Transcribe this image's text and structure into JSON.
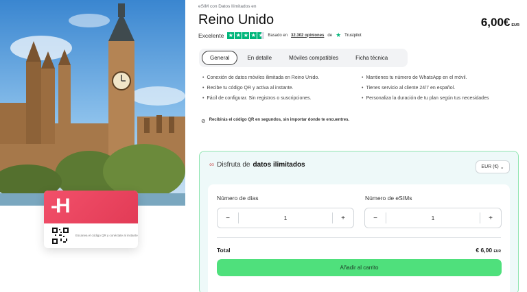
{
  "product": {
    "subtitle": "eSIM con Datos Ilimitados en",
    "title": "Reino Unido",
    "price": "6,00€",
    "price_currency": "EUR"
  },
  "rating": {
    "label": "Excelente",
    "based_on": "Basado en",
    "count": "32.302 opiniones",
    "on": "de",
    "source": "Trustpilot",
    "stars": 4.5
  },
  "tabs": [
    {
      "label": "General",
      "active": true
    },
    {
      "label": "En detalle",
      "active": false
    },
    {
      "label": "Móviles compatibles",
      "active": false
    },
    {
      "label": "Ficha técnica",
      "active": false
    }
  ],
  "features": {
    "left": [
      "Conexión de datos móviles ilimitada en Reino Unido.",
      "Recibe tu código QR y activa al instante.",
      "Fácil de configurar. Sin registros o suscripciones."
    ],
    "right": [
      "Mantienes tu número de WhatsApp en el móvil.",
      "Tienes servicio al cliente 24/7 en español.",
      "Personaliza la duración de tu plan según tus necesidades"
    ]
  },
  "note": "Recibirás el código QR en segundos, sin importar donde te encuentres.",
  "card": {
    "text": "Escanea el código QR y conéctate al instante"
  },
  "plan": {
    "heading_prefix": "Disfruta de",
    "heading_bold": "datos ilimitados",
    "currency_select": "EUR (€)",
    "days_label": "Número de días",
    "days_value": "1",
    "esims_label": "Número de eSIMs",
    "esims_value": "1",
    "minus": "−",
    "plus": "+",
    "total_label": "Total",
    "total_value": "€ 6,00",
    "total_currency": "EUR",
    "cart_button": "Añadir al carrito"
  },
  "colors": {
    "accent_green": "#4fe07c",
    "trustpilot_green": "#00b67a",
    "brand_red": "#e23b56"
  }
}
